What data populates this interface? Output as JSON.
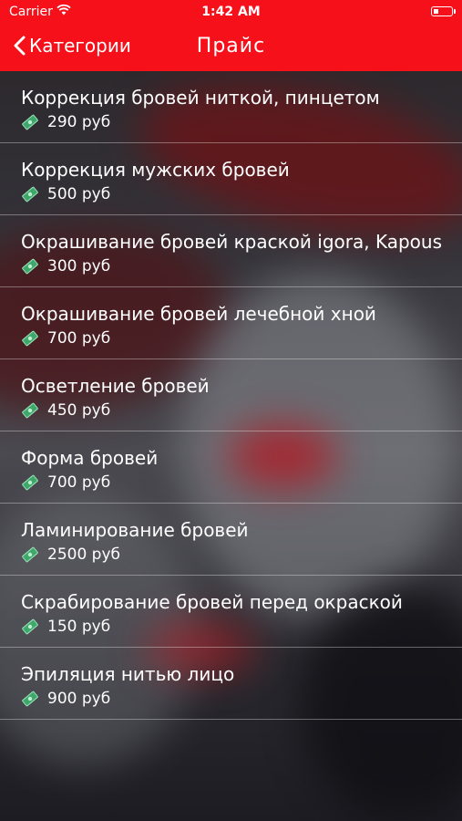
{
  "status_bar": {
    "carrier": "Carrier",
    "time": "1:42 AM"
  },
  "nav": {
    "back_label": "Категории",
    "title": "Прайс"
  },
  "accent_color": "#f5101a",
  "price_icon": "money-bill-icon",
  "items": [
    {
      "name": "Коррекция  бровей ниткой, пинцетом",
      "price": "290 руб"
    },
    {
      "name": "Коррекция мужских бровей",
      "price": "500 руб"
    },
    {
      "name": "Окрашивание бровей краской igora, Kapous",
      "price": "300 руб"
    },
    {
      "name": "Окрашивание бровей лечебной хной",
      "price": "700 руб"
    },
    {
      "name": "Осветление бровей",
      "price": "450 руб"
    },
    {
      "name": "Форма бровей",
      "price": "700 руб"
    },
    {
      "name": "Ламинирование бровей",
      "price": "2500 руб"
    },
    {
      "name": "Скрабирование бровей перед окраской",
      "price": "150 руб"
    },
    {
      "name": "Эпиляция нитью лицо",
      "price": "900 руб"
    }
  ]
}
